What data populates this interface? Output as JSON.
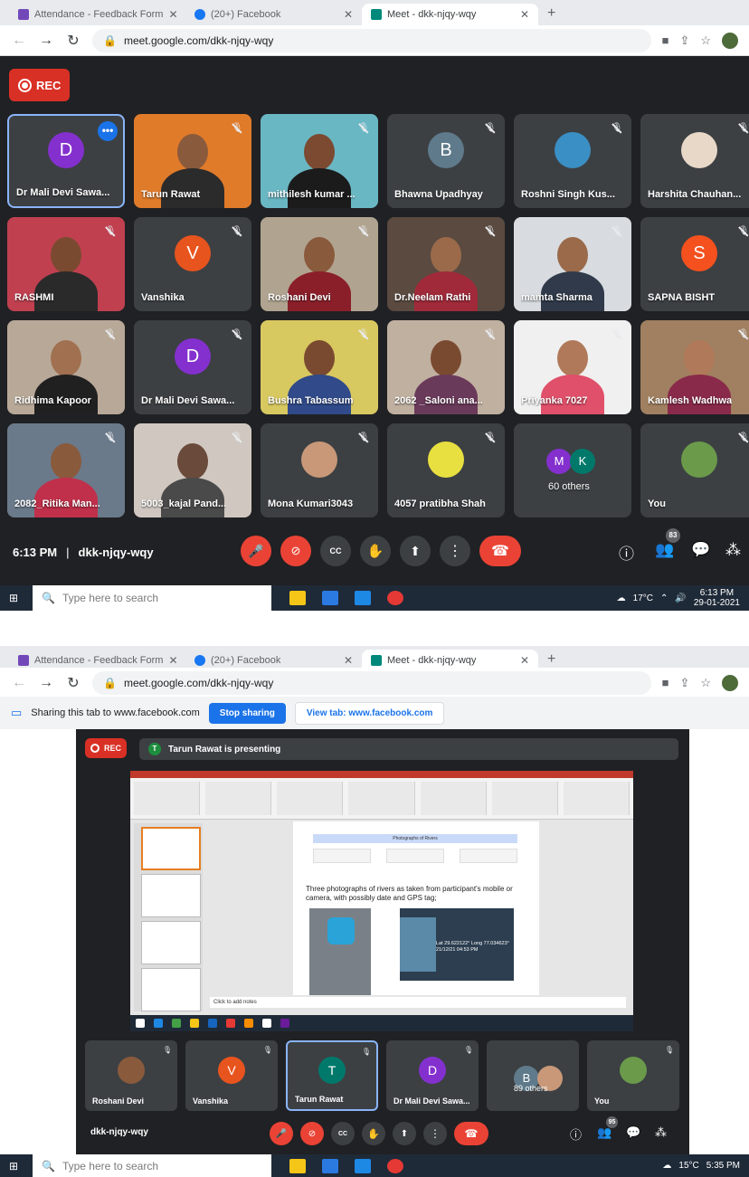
{
  "browser_top": {
    "tabs": [
      {
        "title": "Attendance - Feedback Form",
        "fav_color": "#7248b9"
      },
      {
        "title": "(20+) Facebook",
        "fav_color": "#1877f2"
      },
      {
        "title": "Meet - dkk-njqy-wqy",
        "fav_color": "#00897b"
      }
    ],
    "url": "meet.google.com/dkk-njqy-wqy"
  },
  "meet_top": {
    "rec_label": "REC",
    "tiles": [
      {
        "name": "Dr Mali Devi Sawa...",
        "type": "initial",
        "initial": "D",
        "color": "#8430ce",
        "selected": true
      },
      {
        "name": "Tarun Rawat",
        "type": "video",
        "bg": "#e07b2a",
        "skin": "#8a5a3c",
        "shirt": "#2b2b2b"
      },
      {
        "name": "mithilesh kumar ...",
        "type": "video",
        "bg": "#6ab7c4",
        "skin": "#7b4a30",
        "shirt": "#1b1b1b"
      },
      {
        "name": "Bhawna Upadhyay",
        "type": "initial",
        "initial": "B",
        "color": "#5f7a8a"
      },
      {
        "name": "Roshni Singh Kus...",
        "type": "photo",
        "bg": "#3a8fc4"
      },
      {
        "name": "Harshita Chauhan...",
        "type": "photo",
        "bg": "#e8d8c8"
      },
      {
        "name": "RASHMI",
        "type": "video",
        "bg": "#c04050",
        "skin": "#7a4a30",
        "shirt": "#2a2a2a"
      },
      {
        "name": "Vanshika",
        "type": "initial",
        "initial": "V",
        "color": "#e8541e"
      },
      {
        "name": "Roshani Devi",
        "type": "video",
        "bg": "#b0a490",
        "skin": "#8a5a3c",
        "shirt": "#8a1f2a"
      },
      {
        "name": "Dr.Neelam Rathi",
        "type": "video",
        "bg": "#5a4a40",
        "skin": "#9a6a4a",
        "shirt": "#a02a3a"
      },
      {
        "name": "mamta Sharma",
        "type": "video",
        "bg": "#d8dce0",
        "skin": "#9a6a4a",
        "shirt": "#303a4a"
      },
      {
        "name": "SAPNA BISHT",
        "type": "initial",
        "initial": "S",
        "color": "#f4511e"
      },
      {
        "name": "Ridhima Kapoor",
        "type": "video",
        "bg": "#b8a898",
        "skin": "#a07050",
        "shirt": "#202020"
      },
      {
        "name": "Dr Mali Devi Sawa...",
        "type": "initial",
        "initial": "D",
        "color": "#8430ce"
      },
      {
        "name": "Bushra Tabassum",
        "type": "video",
        "bg": "#d8c860",
        "skin": "#7a4a30",
        "shirt": "#304a8a"
      },
      {
        "name": "2062 _Saloni ana...",
        "type": "video",
        "bg": "#c0b0a0",
        "skin": "#7a4a30",
        "shirt": "#6a3a5a"
      },
      {
        "name": "Priyanka 7027",
        "type": "video",
        "bg": "#f0f0f0",
        "skin": "#b07a5a",
        "shirt": "#e0506a"
      },
      {
        "name": "Kamlesh Wadhwa",
        "type": "video",
        "bg": "#a08060",
        "skin": "#b07a5a",
        "shirt": "#8a2a4a"
      },
      {
        "name": "2082_Ritika Man...",
        "type": "video",
        "bg": "#6a7a8a",
        "skin": "#8a5a3c",
        "shirt": "#c0304a"
      },
      {
        "name": "5003_kajal Pand...",
        "type": "video",
        "bg": "#d0c8c0",
        "skin": "#6a4a3a",
        "shirt": "#4a4a4a"
      },
      {
        "name": "Mona Kumari3043",
        "type": "photo",
        "bg": "#c89878"
      },
      {
        "name": "4057 pratibha Shah",
        "type": "photo",
        "bg": "#e8e040"
      },
      {
        "name": "60 others",
        "type": "others",
        "avatars": [
          {
            "initial": "M",
            "color": "#8430ce"
          },
          {
            "initial": "K",
            "color": "#00796b"
          }
        ]
      },
      {
        "name": "You",
        "type": "photo",
        "bg": "#6a9a4a"
      }
    ],
    "time": "6:13 PM",
    "separator": "|",
    "meeting_code": "dkk-njqy-wqy",
    "participant_count": "83",
    "cc_label": "CC"
  },
  "taskbar_top": {
    "search_placeholder": "Type here to search",
    "temp": "17°C",
    "time": "6:13 PM",
    "date": "29-01-2021"
  },
  "browser_bottom": {
    "tabs": [
      {
        "title": "Attendance - Feedback Form",
        "fav_color": "#7248b9"
      },
      {
        "title": "(20+) Facebook",
        "fav_color": "#1877f2"
      },
      {
        "title": "Meet - dkk-njqy-wqy",
        "fav_color": "#00897b"
      }
    ],
    "url": "meet.google.com/dkk-njqy-wqy"
  },
  "sharing": {
    "text": "Sharing this tab to www.facebook.com",
    "stop": "Stop sharing",
    "view": "View tab: www.facebook.com"
  },
  "meet_bottom": {
    "rec_label": "REC",
    "presenter_initial": "T",
    "presenting_text": "Tarun Rawat is presenting",
    "slide": {
      "header": "Photographs of Rivers",
      "text": "Three photographs of rivers as taken from participant's mobile or camera, with possibly date and GPS tag;",
      "gps": "Lat 29.622122° Long 77.034623° 21/12/21 04:53 PM",
      "note": "Click to add notes"
    },
    "tiles": [
      {
        "name": "Roshani Devi",
        "type": "photo",
        "bg": "#8a5a3c"
      },
      {
        "name": "Vanshika",
        "type": "initial",
        "initial": "V",
        "color": "#e8541e"
      },
      {
        "name": "Tarun Rawat",
        "type": "initial",
        "initial": "T",
        "color": "#00796b",
        "selected": true
      },
      {
        "name": "Dr Mali Devi Sawa...",
        "type": "initial",
        "initial": "D",
        "color": "#8430ce"
      },
      {
        "name": "89 others",
        "type": "others",
        "avatars": [
          {
            "initial": "B",
            "color": "#5f7a8a"
          },
          {
            "initial": "",
            "color": "#c89878"
          }
        ]
      },
      {
        "name": "You",
        "type": "photo",
        "bg": "#6a9a4a"
      }
    ],
    "meeting_code": "dkk-njqy-wqy",
    "participant_count": "95",
    "cc_label": "CC"
  },
  "taskbar_bottom": {
    "search_placeholder": "Type here to search",
    "temp": "15°C",
    "time": "5:35 PM"
  }
}
